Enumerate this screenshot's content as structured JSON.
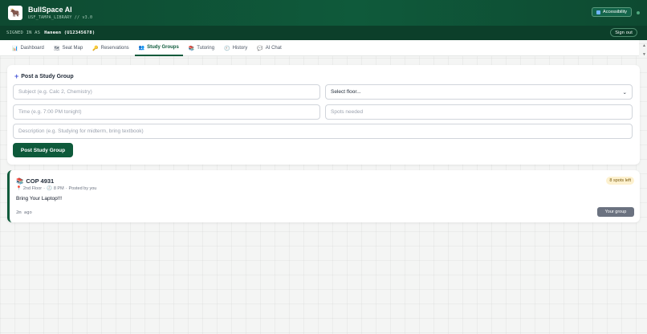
{
  "header": {
    "logo_glyph": "🐂",
    "title": "BullSpace AI",
    "subtitle": "USF_TAMPA_LIBRARY // v3.0",
    "accessibility_label": "Accessibility"
  },
  "signin": {
    "label": "SIGNED IN AS",
    "user": "Haneen (U12345678)",
    "signout_label": "Sign out"
  },
  "tabs": [
    {
      "icon": "📊",
      "label": "Dashboard"
    },
    {
      "icon": "🗺",
      "label": "Seat Map"
    },
    {
      "icon": "🔑",
      "label": "Reservations"
    },
    {
      "icon": "👥",
      "label": "Study Groups"
    },
    {
      "icon": "📚",
      "label": "Tutoring"
    },
    {
      "icon": "🕘",
      "label": "History"
    },
    {
      "icon": "💬",
      "label": "AI Chat"
    }
  ],
  "active_tab": "Study Groups",
  "post_form": {
    "title": "Post a Study Group",
    "subject_placeholder": "Subject (e.g. Calc 2, Chemistry)",
    "floor_select_value": "Select floor...",
    "time_placeholder": "Time (e.g. 7:00 PM tonight)",
    "spots_placeholder": "Spots needed",
    "description_placeholder": "Description (e.g. Studying for midterm, bring textbook)",
    "submit_label": "Post Study Group"
  },
  "group": {
    "icon": "📚",
    "title": "COP 4931",
    "pin_icon": "📍",
    "floor": "2nd Floor",
    "sep1": "·",
    "clock_icon": "🕗",
    "time": "8 PM",
    "sep2": "·",
    "posted_by": "Posted by you",
    "description": "Bring Your Laptop!!!",
    "age": "2m ago",
    "spots_badge": "8 spots left",
    "owner_button": "Your group"
  },
  "colors": {
    "brand_green": "#0e5a3b",
    "spots_badge_bg": "#fdf1cf",
    "owner_button_bg": "#6b7280"
  }
}
